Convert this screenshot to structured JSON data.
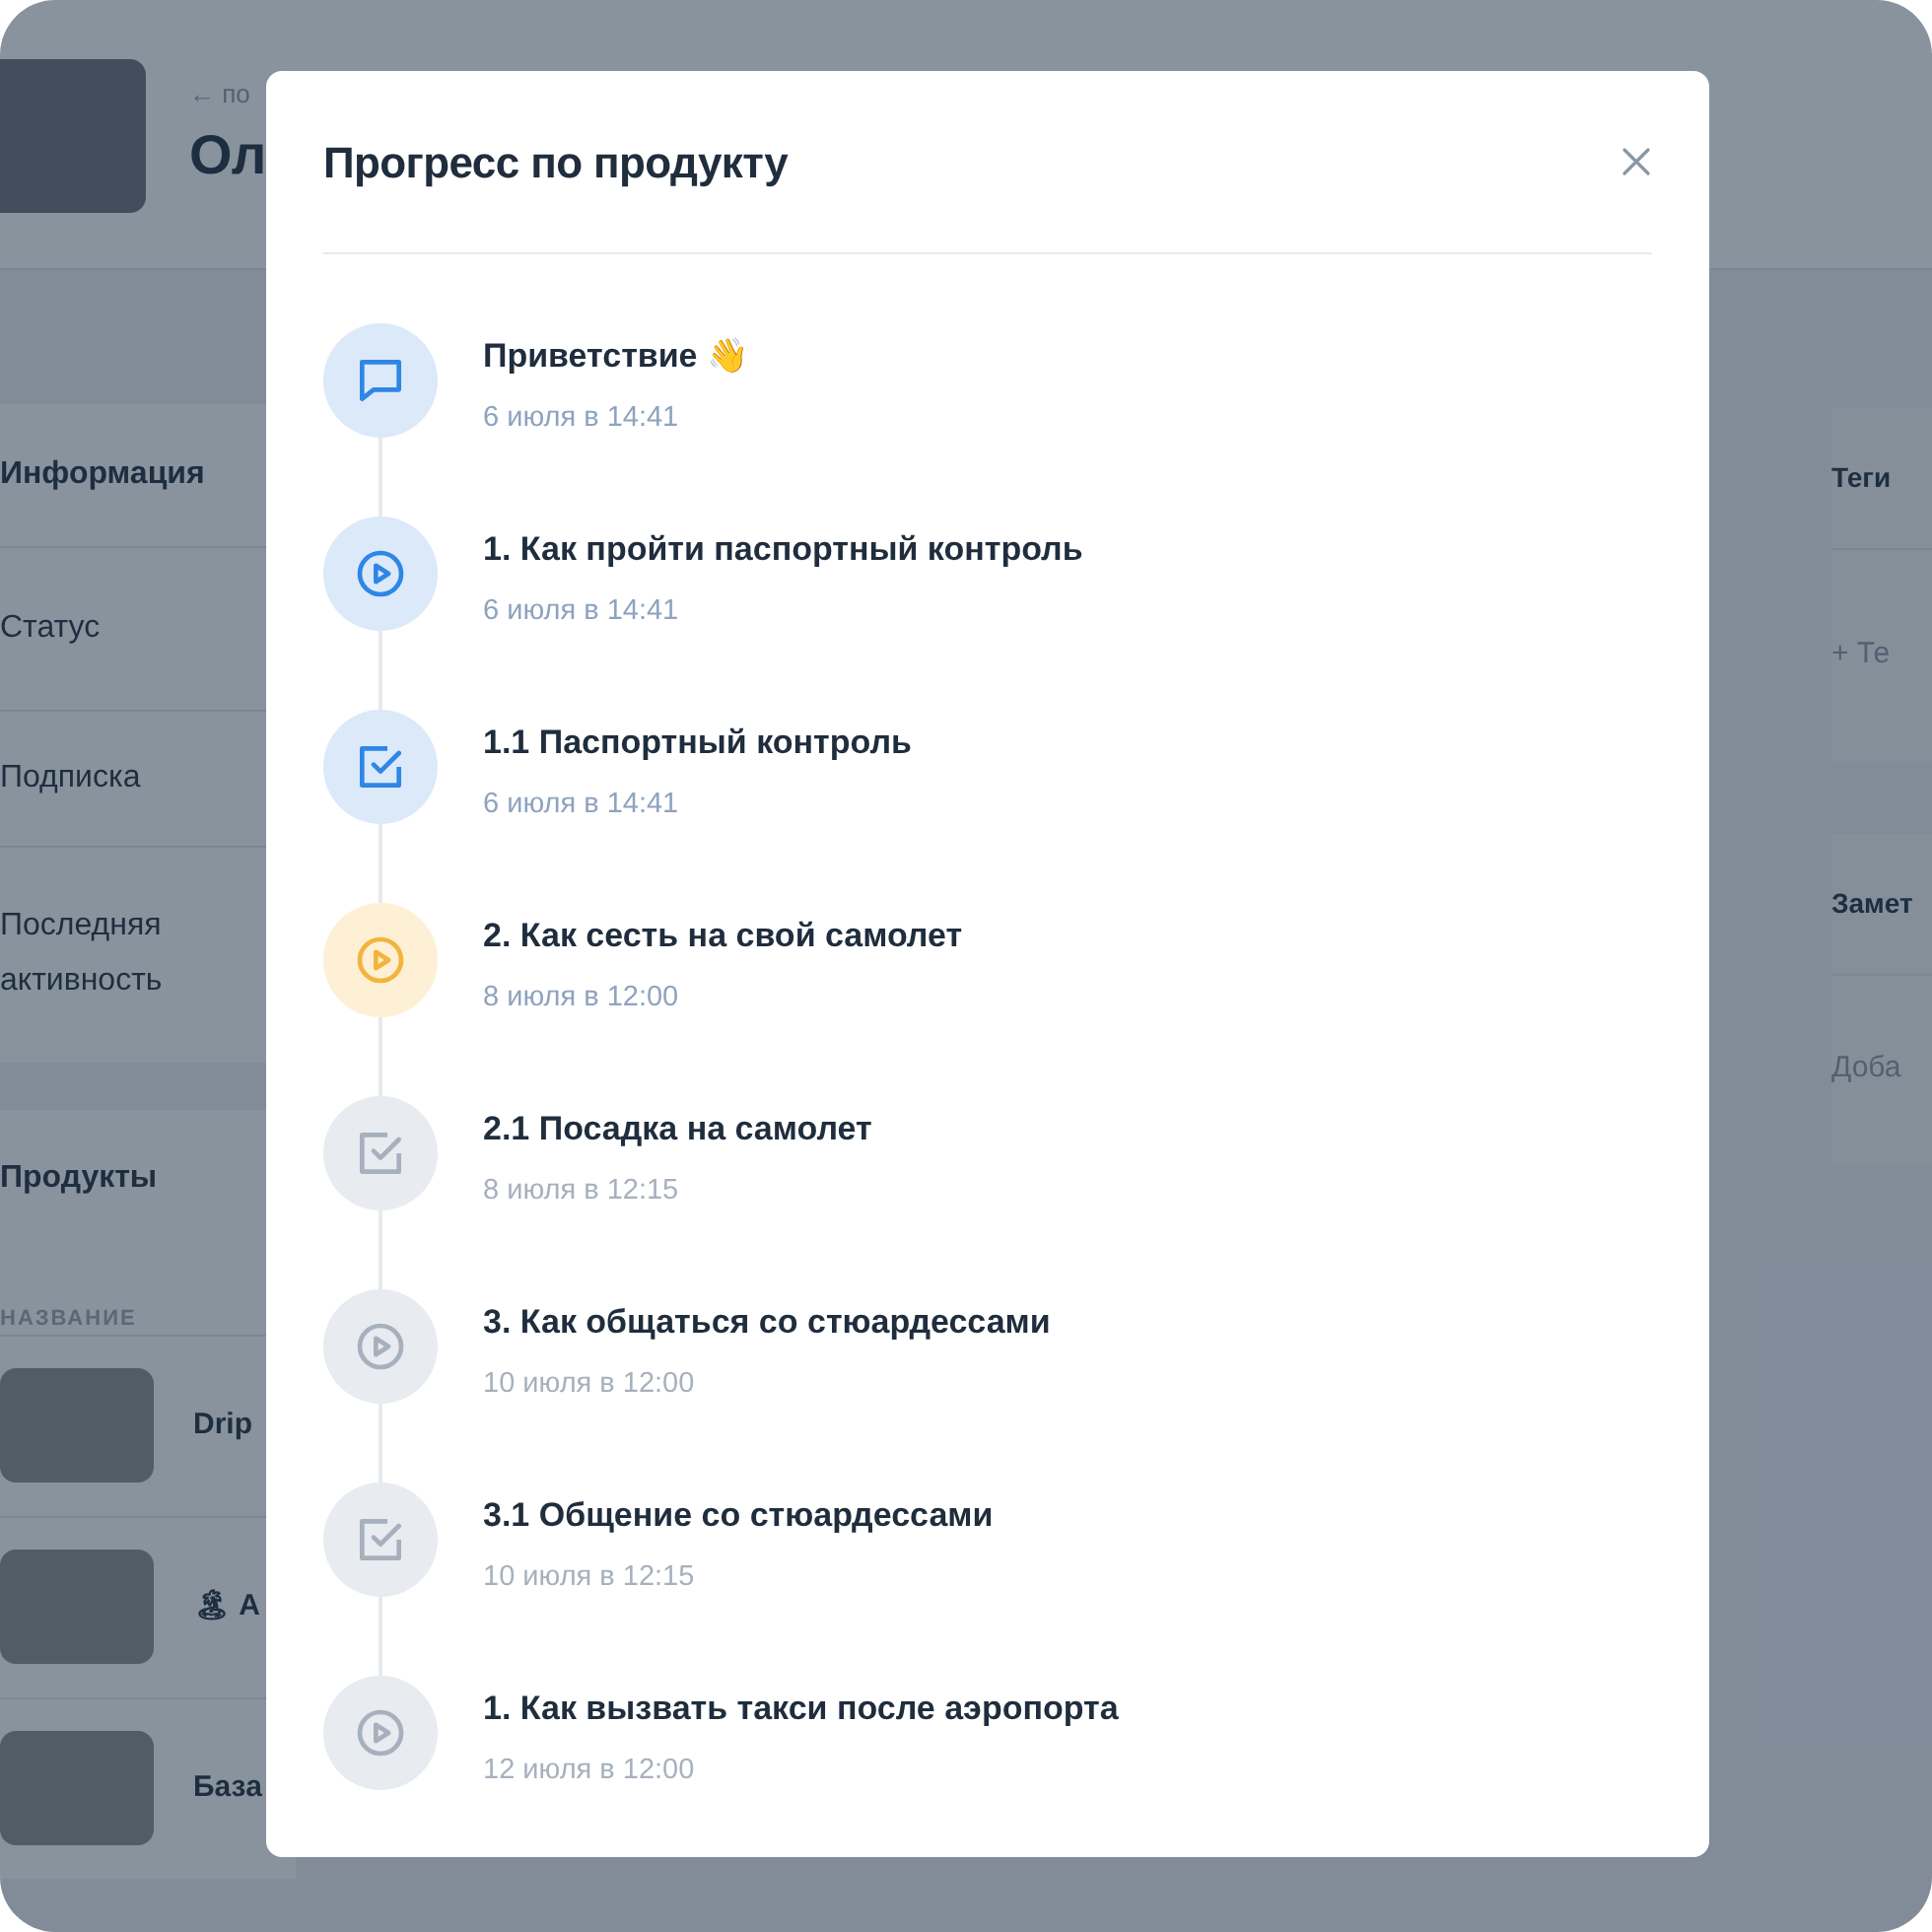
{
  "background": {
    "back_link": "← по",
    "name": "Ол",
    "info": {
      "title": "Информация",
      "rows": [
        "Статус",
        "Подписка",
        "Последняя активность"
      ]
    },
    "products": {
      "title": "Продукты",
      "column": "НАЗВАНИЕ",
      "rows": [
        "Drip",
        "🏝 А",
        "База"
      ]
    },
    "tags": {
      "title": "Теги",
      "add": "+ Те"
    },
    "notes": {
      "title": "Замет",
      "add": "Доба"
    }
  },
  "modal": {
    "title": "Прогресс по продукту",
    "items": [
      {
        "title": "Приветствие 👋",
        "date": "6 июля в 14:41",
        "kind": "message",
        "done": true,
        "active": false
      },
      {
        "title": "1. Как пройти паспортный контроль",
        "date": "6 июля в 14:41",
        "kind": "video",
        "done": true,
        "active": false
      },
      {
        "title": "1.1 Паспортный контроль",
        "date": "6 июля в 14:41",
        "kind": "task",
        "done": true,
        "active": false
      },
      {
        "title": "2. Как сесть на свой самолет",
        "date": "8 июля в 12:00",
        "kind": "video",
        "done": false,
        "active": true
      },
      {
        "title": "2.1 Посадка на самолет",
        "date": "8 июля в 12:15",
        "kind": "task",
        "done": false,
        "active": false
      },
      {
        "title": "3. Как общаться со стюардессами",
        "date": "10 июля в 12:00",
        "kind": "video",
        "done": false,
        "active": false
      },
      {
        "title": "3.1 Общение со стюардессами",
        "date": "10 июля в 12:15",
        "kind": "task",
        "done": false,
        "active": false
      },
      {
        "title": "1. Как вызвать такси после аэропорта",
        "date": "12 июля в 12:00",
        "kind": "video",
        "done": false,
        "active": false
      }
    ]
  }
}
